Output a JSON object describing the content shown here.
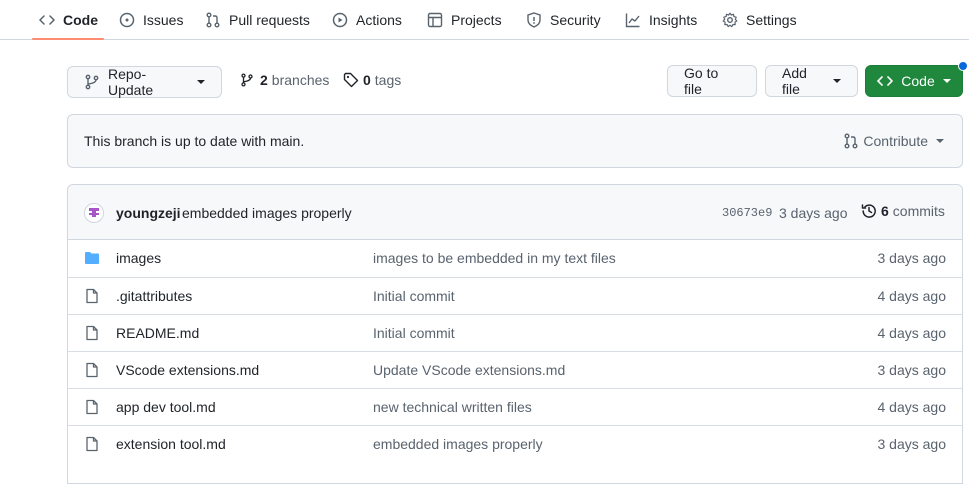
{
  "nav": {
    "tabs": [
      {
        "label": "Code",
        "icon": "code-icon",
        "active": true
      },
      {
        "label": "Issues",
        "icon": "issue-icon"
      },
      {
        "label": "Pull requests",
        "icon": "pull-request-icon"
      },
      {
        "label": "Actions",
        "icon": "play-icon"
      },
      {
        "label": "Projects",
        "icon": "table-icon"
      },
      {
        "label": "Security",
        "icon": "shield-icon"
      },
      {
        "label": "Insights",
        "icon": "graph-icon"
      },
      {
        "label": "Settings",
        "icon": "gear-icon"
      }
    ]
  },
  "toolbar": {
    "branch": "Repo-Update",
    "branches_count": "2",
    "branches_label": "branches",
    "tags_count": "0",
    "tags_label": "tags",
    "go_to_file": "Go to file",
    "add_file": "Add file",
    "code": "Code"
  },
  "banner": {
    "text": "This branch is up to date with main.",
    "contribute": "Contribute"
  },
  "commit": {
    "author": "youngzeji",
    "message": "embedded images properly",
    "hash": "30673e9",
    "time": "3 days ago",
    "commits_count": "6",
    "commits_label": "commits"
  },
  "files": [
    {
      "name": "images",
      "type": "folder",
      "message": "images to be embedded in my text files",
      "time": "3 days ago"
    },
    {
      "name": ".gitattributes",
      "type": "file",
      "message": "Initial commit",
      "time": "4 days ago"
    },
    {
      "name": "README.md",
      "type": "file",
      "message": "Initial commit",
      "time": "4 days ago"
    },
    {
      "name": "VScode extensions.md",
      "type": "file",
      "message": "Update VScode extensions.md",
      "time": "3 days ago"
    },
    {
      "name": "app dev tool.md",
      "type": "file",
      "message": "new technical written files",
      "time": "4 days ago"
    },
    {
      "name": "extension tool.md",
      "type": "file",
      "message": "embedded images properly",
      "time": "3 days ago"
    }
  ],
  "colors": {
    "accent_underline": "#fd8c73",
    "primary_green": "#1f883d",
    "folder_blue": "#54aeff",
    "notification_dot": "#0969da"
  }
}
